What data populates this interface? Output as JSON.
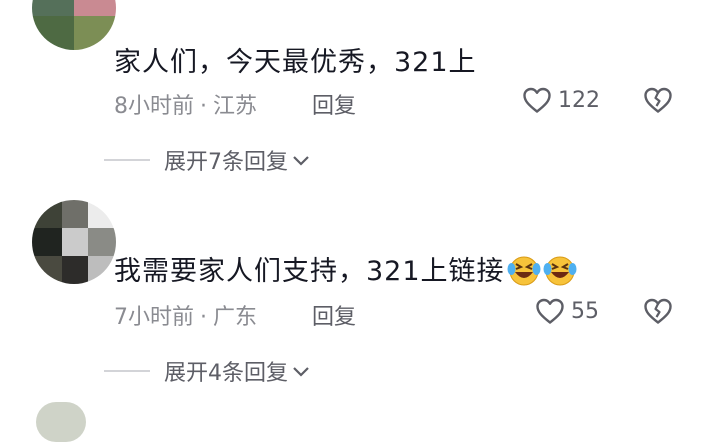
{
  "comments": [
    {
      "text": "家人们，今天最优秀，321上",
      "time": "8小时前",
      "location": "江苏",
      "reply_label": "回复",
      "likes": "122",
      "expand_label": "展开7条回复",
      "emoji_count": 0
    },
    {
      "text": "我需要家人们支持，321上链接",
      "time": "7小时前",
      "location": "广东",
      "reply_label": "回复",
      "likes": "55",
      "expand_label": "展开4条回复",
      "emoji_count": 2
    }
  ],
  "separator": "·",
  "icons": {
    "like": "heart-outline-icon",
    "dislike": "broken-heart-icon",
    "expand": "chevron-down-icon",
    "emoji": "laughing-crying-emoji-icon"
  },
  "colors": {
    "text": "#161823",
    "meta": "#8a8b91",
    "action": "#5d5e66",
    "emoji_face": "#f7c33a"
  }
}
